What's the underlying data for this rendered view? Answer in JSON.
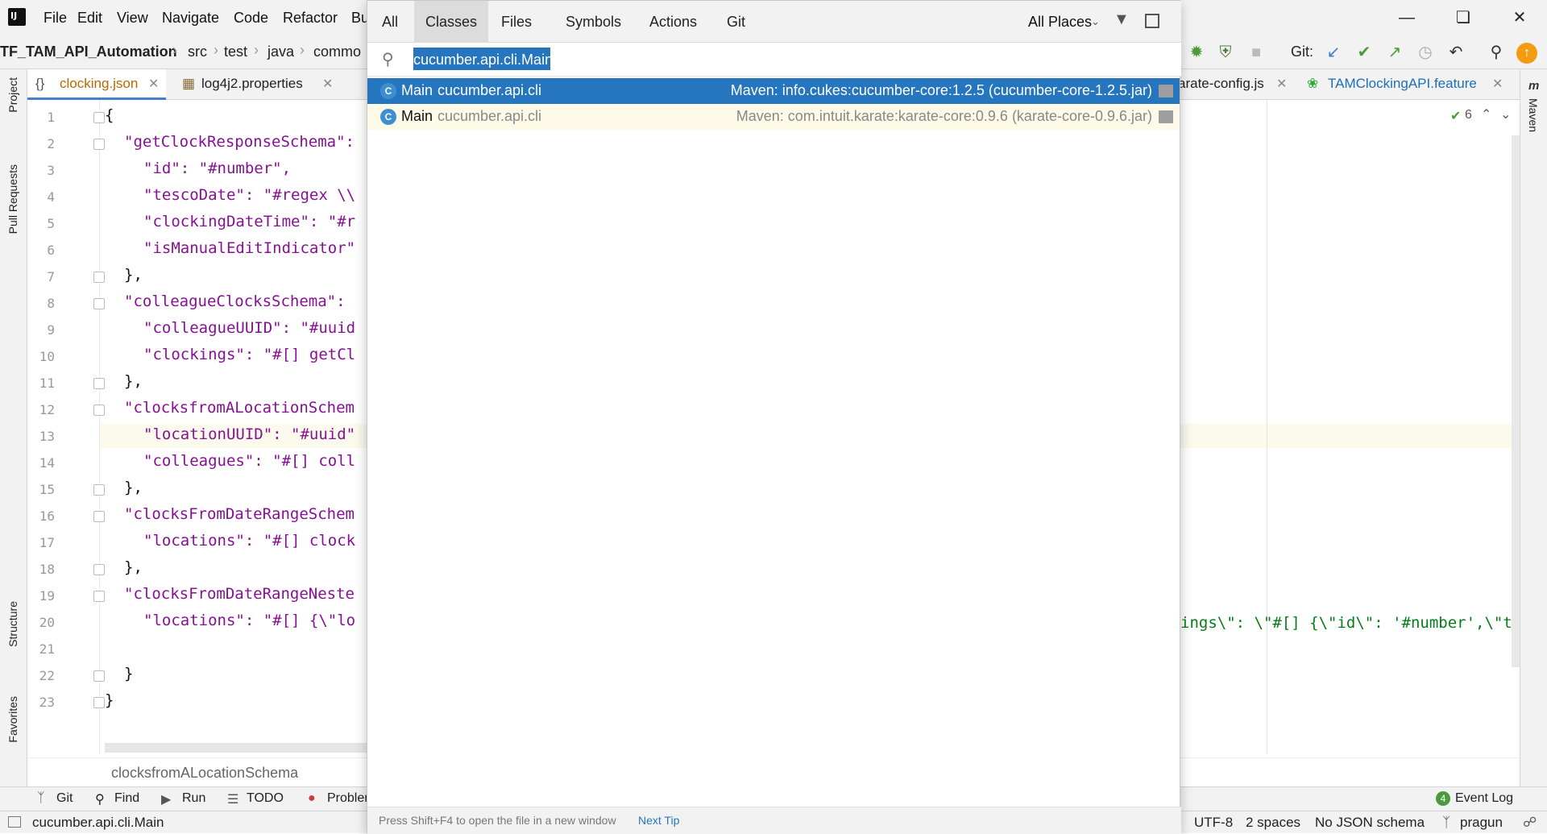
{
  "menubar": {
    "items": [
      "File",
      "Edit",
      "View",
      "Navigate",
      "Code",
      "Refactor",
      "Bu"
    ]
  },
  "breadcrumb": [
    "TF_TAM_API_Automation",
    "src",
    "test",
    "java",
    "commo"
  ],
  "toolbar": {
    "git_label": "Git:"
  },
  "tabs": [
    {
      "label": "clocking.json"
    },
    {
      "label": "log4j2.properties"
    },
    {
      "label": "arate-config.js"
    },
    {
      "label": "TAMClockingAPI.feature"
    }
  ],
  "left_tools": [
    "Project",
    "Pull Requests",
    "Structure",
    "Favorites"
  ],
  "right_tools": [
    "Maven"
  ],
  "editor": {
    "inspection_count": "6",
    "breadcrumb": "clocksfromALocationSchema",
    "lines": [
      {
        "n": "1",
        "code": "{"
      },
      {
        "n": "2",
        "code": "\"getClockResponseSchema\":"
      },
      {
        "n": "3",
        "code": "\"id\": \"#number\","
      },
      {
        "n": "4",
        "code": "\"tescoDate\": \"#regex \\\\"
      },
      {
        "n": "5",
        "code": "\"clockingDateTime\": \"#r"
      },
      {
        "n": "6",
        "code": "\"isManualEditIndicator\""
      },
      {
        "n": "7",
        "code": "},"
      },
      {
        "n": "8",
        "code": "\"colleagueClocksSchema\":"
      },
      {
        "n": "9",
        "code": "\"colleagueUUID\": \"#uuid"
      },
      {
        "n": "10",
        "code": "\"clockings\": \"#[] getCl"
      },
      {
        "n": "11",
        "code": "},"
      },
      {
        "n": "12",
        "code": "\"clocksfromALocationSchem"
      },
      {
        "n": "13",
        "code": "\"locationUUID\": \"#uuid\""
      },
      {
        "n": "14",
        "code": "\"colleagues\": \"#[] coll"
      },
      {
        "n": "15",
        "code": "},"
      },
      {
        "n": "16",
        "code": "\"clocksFromDateRangeSchem"
      },
      {
        "n": "17",
        "code": "\"locations\": \"#[] clock"
      },
      {
        "n": "18",
        "code": "},"
      },
      {
        "n": "19",
        "code": "\"clocksFromDateRangeNeste"
      },
      {
        "n": "20",
        "code": "\"locations\": \"#[] {\\\"lo"
      },
      {
        "n": "21",
        "code": ""
      },
      {
        "n": "22",
        "code": "}"
      },
      {
        "n": "23",
        "code": "}"
      }
    ],
    "line20_tail": "ings\\\": \\\"#[] {\\\"id\\\": '#number',\\\"t"
  },
  "popup": {
    "tabs": [
      "All",
      "Classes",
      "Files",
      "Symbols",
      "Actions",
      "Git"
    ],
    "active_tab": "Classes",
    "scope": "All Places",
    "search_value": "cucumber.api.cli.Main",
    "results": [
      {
        "name": "Main",
        "package": "cucumber.api.cli",
        "location": "Maven: info.cukes:cucumber-core:1.2.5 (cucumber-core-1.2.5.jar)",
        "selected": true
      },
      {
        "name": "Main",
        "package": "cucumber.api.cli",
        "location": "Maven: com.intuit.karate:karate-core:0.9.6 (karate-core-0.9.6.jar)",
        "selected": false
      }
    ],
    "footer_hint": "Press Shift+F4 to open the file in a new window",
    "footer_link": "Next Tip"
  },
  "toolwindows": [
    "Git",
    "Find",
    "Run",
    "TODO",
    "Problen"
  ],
  "event_log": {
    "label": "Event Log",
    "count": "4"
  },
  "statusbar": {
    "message": "cucumber.api.cli.Main",
    "encoding": "UTF-8",
    "indent": "2 spaces",
    "schema": "No JSON schema",
    "branch": "pragun"
  }
}
